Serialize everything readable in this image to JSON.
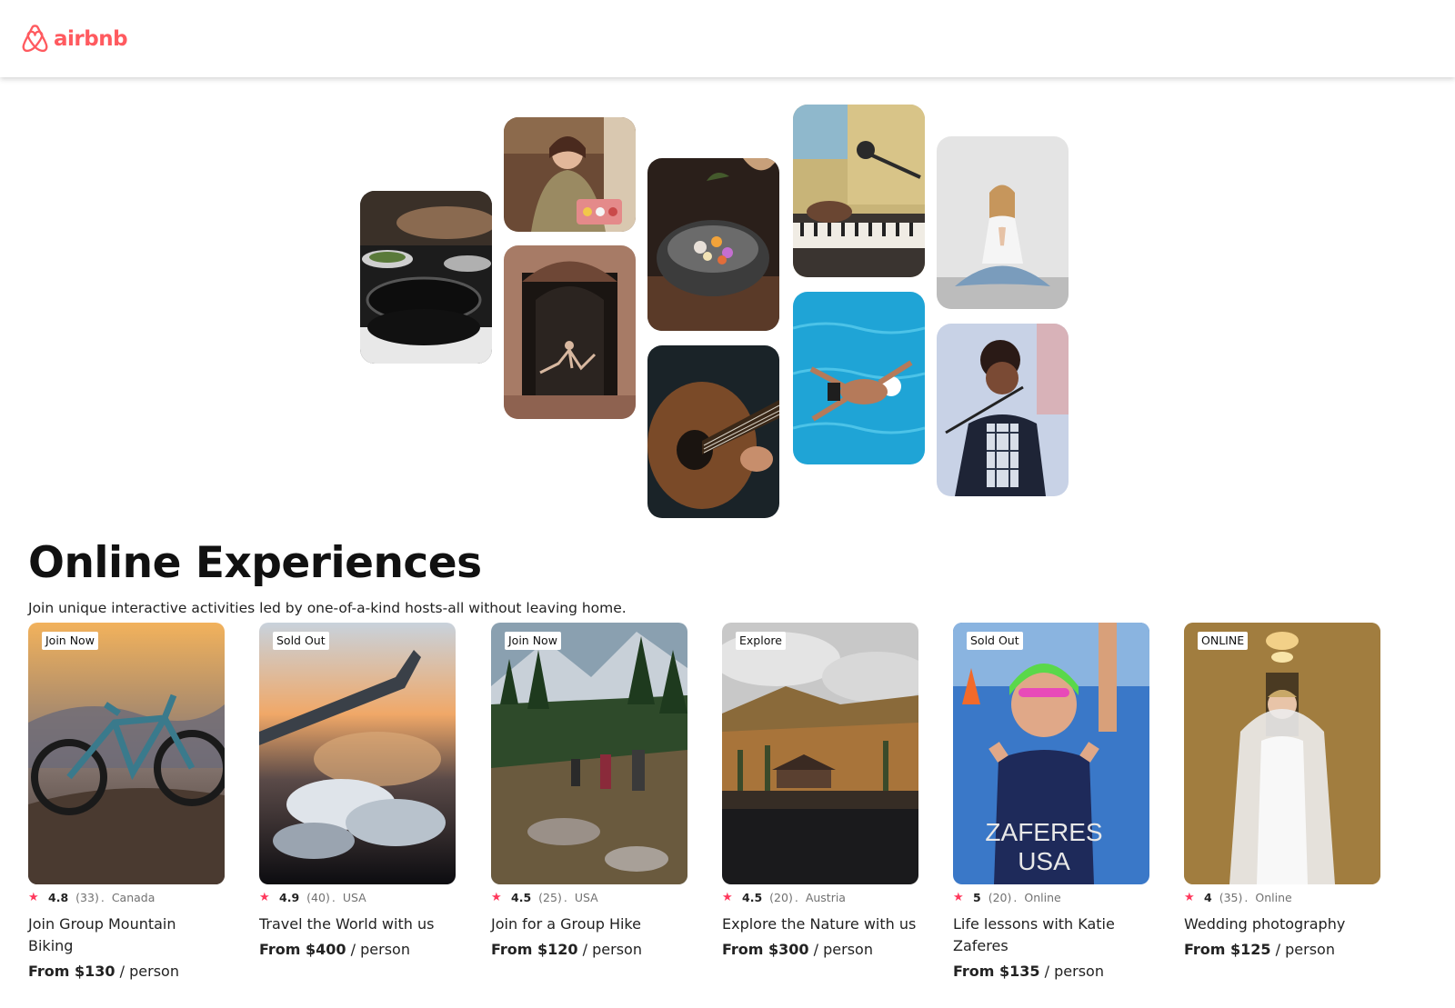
{
  "brand": {
    "name": "airbnb",
    "color": "#ff5a5f",
    "icon": "airbnb-belo-icon"
  },
  "hero": {
    "photos": [
      {
        "name": "cooking-pans-photo"
      },
      {
        "name": "baker-with-pastries-photo"
      },
      {
        "name": "dancer-in-doorway-photo"
      },
      {
        "name": "food-bowl-photo"
      },
      {
        "name": "guitar-player-photo"
      },
      {
        "name": "piano-and-microphone-photo"
      },
      {
        "name": "swimmer-in-pool-photo"
      },
      {
        "name": "yoga-meditation-photo"
      },
      {
        "name": "singer-on-stage-photo"
      }
    ]
  },
  "section": {
    "title": "Online Experiences",
    "subtitle": "Join unique interactive activities led by one-of-a-kind hosts-all without leaving home."
  },
  "cards": [
    {
      "badge": "Join Now",
      "rating": "4.8",
      "reviews": "(33)",
      "location": "Canada",
      "title": "Join Group Mountain Biking",
      "price_from": "From $130",
      "price_unit": " / person"
    },
    {
      "badge": "Sold Out",
      "rating": "4.9",
      "reviews": "(40)",
      "location": "USA",
      "title": "Travel the World with us",
      "price_from": "From $400",
      "price_unit": " / person"
    },
    {
      "badge": "Join Now",
      "rating": "4.5",
      "reviews": "(25)",
      "location": "USA",
      "title": "Join for a Group Hike",
      "price_from": "From $120",
      "price_unit": " / person"
    },
    {
      "badge": "Explore",
      "rating": "4.5",
      "reviews": "(20)",
      "location": "Austria",
      "title": "Explore the Nature with us",
      "price_from": "From $300",
      "price_unit": " / person"
    },
    {
      "badge": "Sold Out",
      "rating": "5",
      "reviews": "(20)",
      "location": "Online",
      "title": "Life lessons with Katie Zaferes",
      "price_from": "From $135",
      "price_unit": " / person"
    },
    {
      "badge": "ONLINE",
      "rating": "4",
      "reviews": "(35)",
      "location": "Online",
      "title": "Wedding photography",
      "price_from": "From $125",
      "price_unit": " / person"
    }
  ],
  "colors": {
    "star": "#ff385c",
    "muted_text": "#717171"
  }
}
